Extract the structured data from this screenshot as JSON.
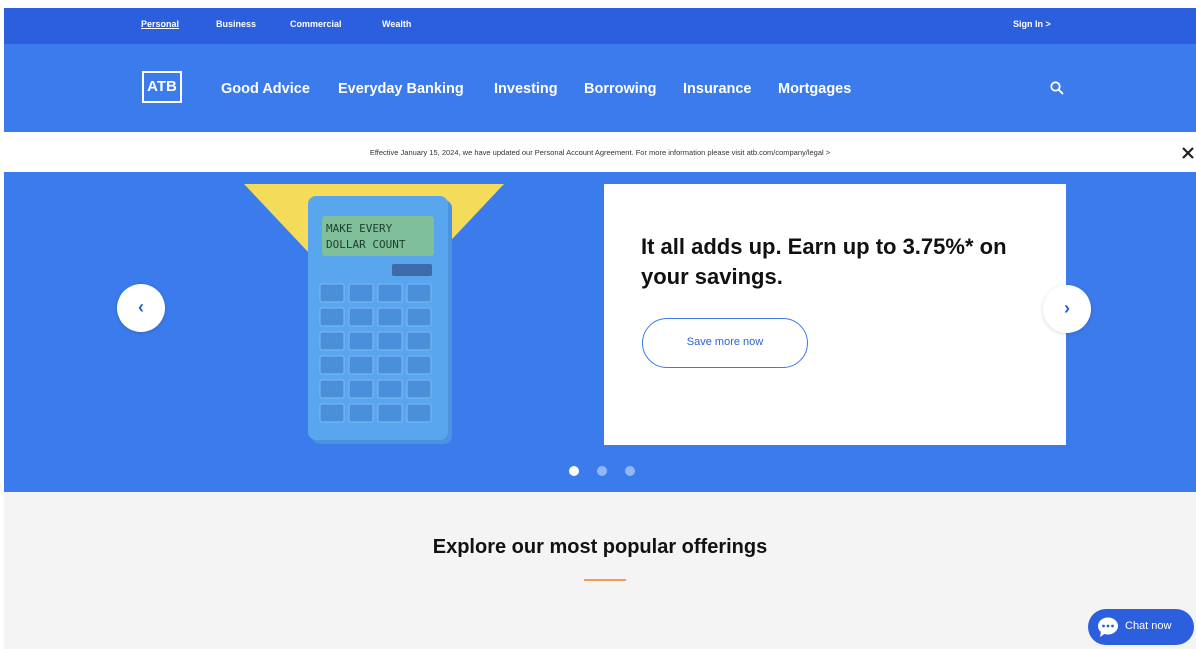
{
  "utility_bar": {
    "links": [
      {
        "label": "Personal",
        "active": true
      },
      {
        "label": "Business",
        "active": false
      },
      {
        "label": "Commercial",
        "active": false
      },
      {
        "label": "Wealth",
        "active": false
      }
    ],
    "sign_in": "Sign In >"
  },
  "nav": {
    "logo": "ATB",
    "links": [
      "Good Advice",
      "Everyday Banking",
      "Investing",
      "Borrowing",
      "Insurance",
      "Mortgages"
    ],
    "search_icon": "search-icon"
  },
  "notice": {
    "text": "Effective January 15, 2024, we have updated our Personal Account Agreement. For more information please visit atb.com/company/legal  >",
    "close_icon": "close-icon"
  },
  "hero": {
    "calculator_display": [
      "MAKE EVERY",
      "DOLLAR COUNT"
    ],
    "promo_title": "It all adds up. Earn up to 3.75%* on your savings.",
    "promo_button": "Save more now",
    "prev_label": "‹",
    "next_label": "›",
    "slide_count": 3,
    "active_slide": 1
  },
  "explore": {
    "title": "Explore our most popular offerings"
  },
  "chat": {
    "label": "Chat now"
  },
  "colors": {
    "brand_dark": "#2b5fde",
    "brand": "#3b7bec",
    "accent_underline": "#f39a5a",
    "calculator": "#5aa6ee",
    "triangle": "#f4dc5a"
  }
}
